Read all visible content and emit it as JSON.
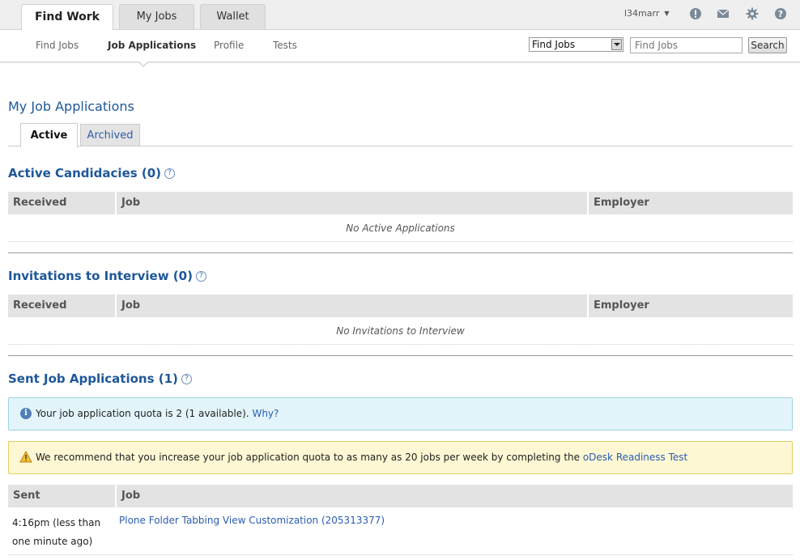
{
  "top_tabs": [
    "Find Work",
    "My Jobs",
    "Wallet"
  ],
  "user": {
    "name": "l34marr"
  },
  "top_icons": [
    "alert-icon",
    "mail-icon",
    "gear-icon",
    "help-icon"
  ],
  "subnav": [
    "Find Jobs",
    "Job Applications",
    "Profile",
    "Tests"
  ],
  "search": {
    "select_value": "Find Jobs",
    "placeholder": "Find Jobs",
    "button": "Search"
  },
  "page": {
    "title": "My Job Applications",
    "tabs": [
      "Active",
      "Archived"
    ]
  },
  "active_candidacies": {
    "heading": "Active Candidacies (0)",
    "columns": [
      "Received",
      "Job",
      "Employer"
    ],
    "empty": "No Active Applications"
  },
  "invitations": {
    "heading": "Invitations to Interview (0)",
    "columns": [
      "Received",
      "Job",
      "Employer"
    ],
    "empty": "No Invitations to Interview"
  },
  "sent": {
    "heading": "Sent Job Applications (1)",
    "info_text": "Your job application quota is 2 (1 available).",
    "info_link": "Why?",
    "warn_text": "We recommend that you increase your job application quota to as many as 20 jobs per week by completing the",
    "warn_link": "oDesk Readiness Test",
    "columns": [
      "Sent",
      "Job"
    ],
    "rows": [
      {
        "sent": "4:16pm (less than one minute ago)",
        "job": "Plone Folder Tabbing View Customization (205313377)"
      }
    ]
  },
  "colors": {
    "heading_blue": "#1e5799",
    "link_blue": "#2a5db0",
    "info_bg": "#e3f5fa",
    "warn_bg": "#fdf7d4"
  }
}
